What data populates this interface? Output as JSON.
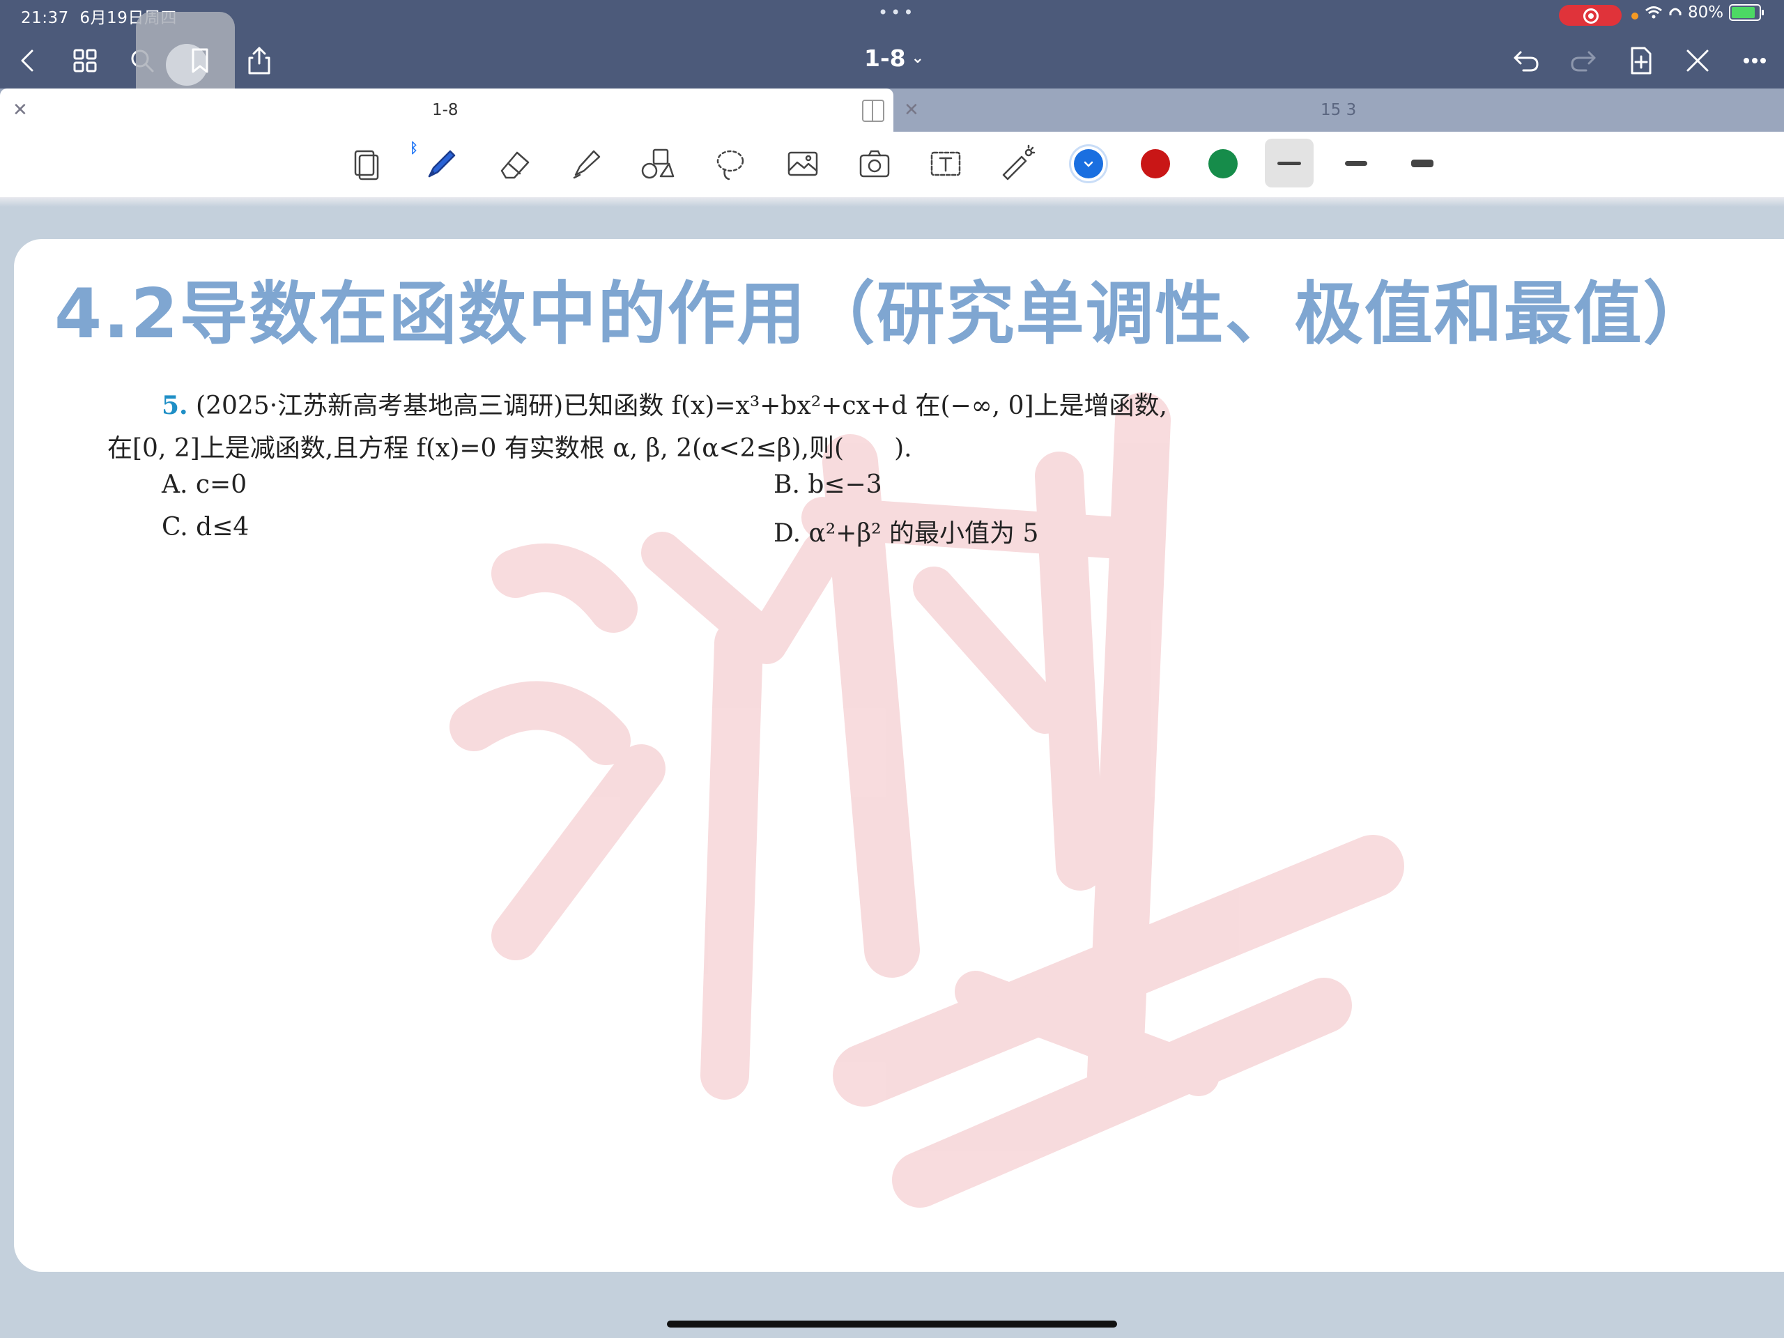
{
  "status": {
    "time": "21:37",
    "date": "6月19日周四",
    "dots": "•••",
    "battery": "80%"
  },
  "nav": {
    "doc_title": "1-8",
    "chevron": "⌄"
  },
  "tabs": [
    {
      "label": "1-8",
      "active": true
    },
    {
      "label": "15 3",
      "active": false
    }
  ],
  "tools": [
    "page-thumbnail",
    "pen",
    "eraser",
    "highlighter",
    "shapes",
    "lasso",
    "image",
    "camera",
    "text",
    "laser-pointer"
  ],
  "colors": {
    "blue": "#1a6fe0",
    "red": "#c91616",
    "green": "#168c4a",
    "selected": "blue"
  },
  "page": {
    "title": "4.2导数在函数中的作用（研究单调性、极值和最值）",
    "question": {
      "number": "5.",
      "line1": "(2025·江苏新高考基地高三调研)已知函数 f(x)=x³+bx²+cx+d 在(−∞, 0]上是增函数,",
      "line2": "在[0, 2]上是减函数,且方程 f(x)=0 有实数根 α, β, 2(α<2≤β),则(　　).",
      "options": {
        "a": "A. c=0",
        "b": "B. b≤−3",
        "c": "C. d≤4",
        "d": "D. α²+β² 的最小值为 5"
      }
    }
  }
}
